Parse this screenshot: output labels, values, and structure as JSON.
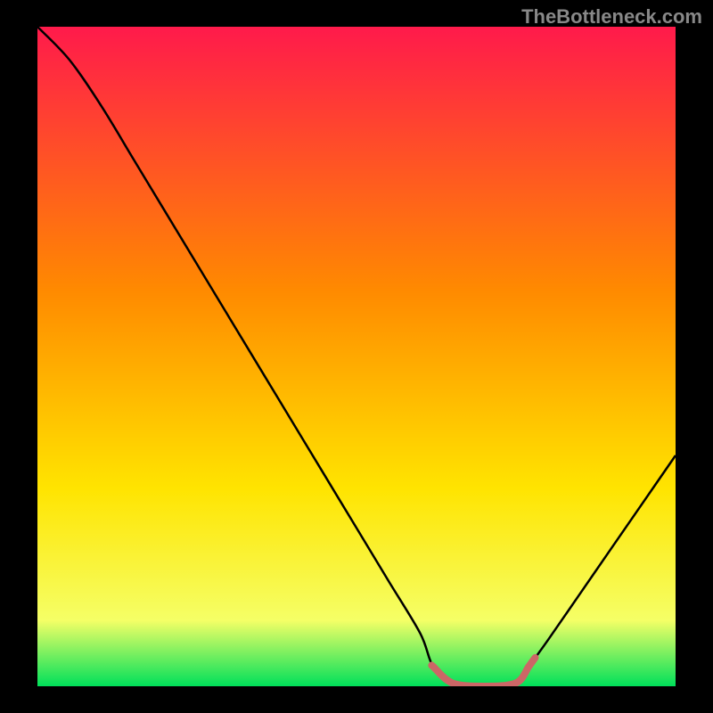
{
  "watermark": "TheBottleneck.com",
  "chart_data": {
    "type": "line",
    "title": "",
    "xlabel": "",
    "ylabel": "",
    "xlim": [
      0,
      100
    ],
    "ylim": [
      0,
      100
    ],
    "x": [
      0,
      5,
      10,
      15,
      20,
      25,
      30,
      35,
      40,
      45,
      50,
      55,
      60,
      62,
      65,
      70,
      75,
      77,
      80,
      85,
      90,
      95,
      100
    ],
    "values": [
      100,
      95,
      88,
      80,
      72,
      64,
      56,
      48,
      40,
      32,
      24,
      16,
      8,
      3,
      0.5,
      0,
      0.5,
      3,
      7,
      14,
      21,
      28,
      35
    ],
    "highlight_range_x": [
      62,
      78
    ],
    "gradient": {
      "start": "#ff1a4b",
      "mid1": "#ff8a00",
      "mid2": "#ffe400",
      "end": "#00e05a"
    },
    "curve_color": "#000000",
    "highlight_color": "#cc6666",
    "background": "#000000"
  }
}
